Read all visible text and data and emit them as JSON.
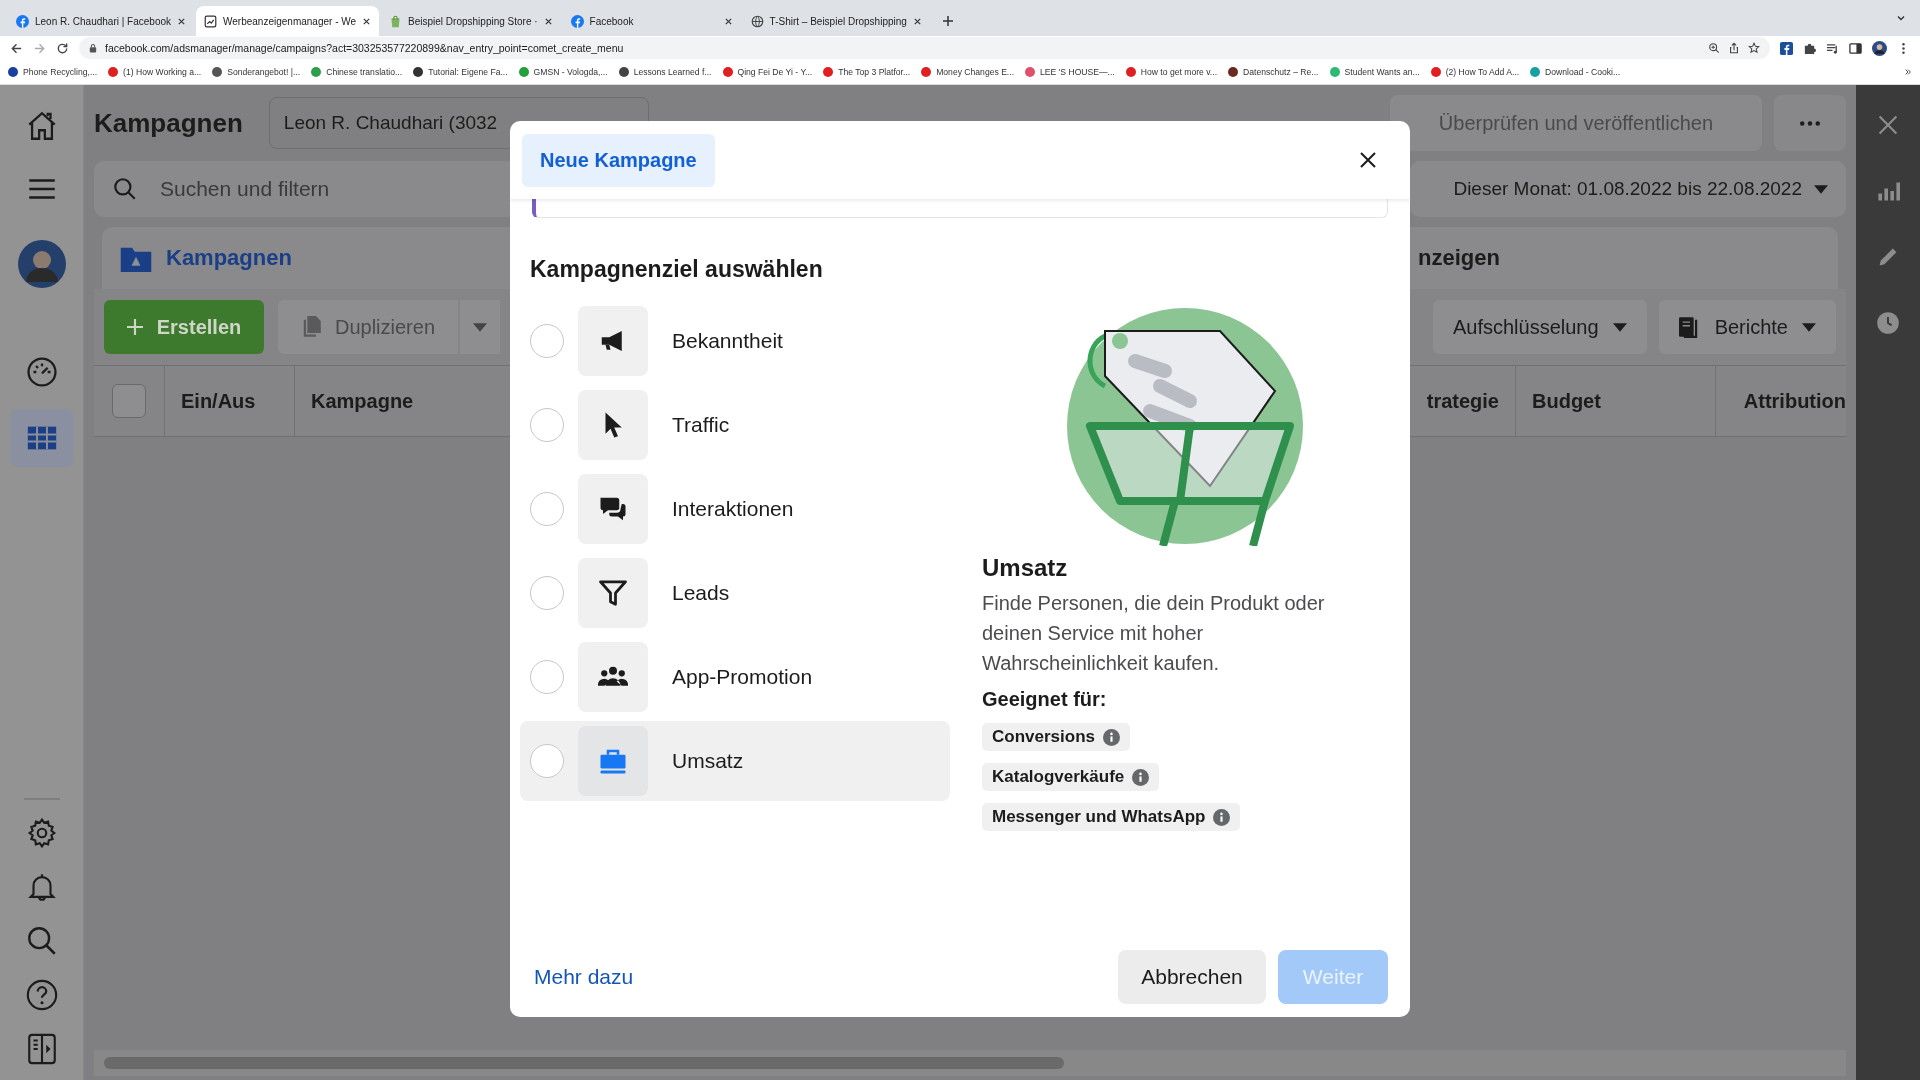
{
  "browser": {
    "tabs": [
      {
        "title": "Leon R. Chaudhari | Facebook",
        "kind": "facebook",
        "selected": false
      },
      {
        "title": "Werbeanzeigenmanager - We",
        "kind": "ads",
        "selected": true
      },
      {
        "title": "Beispiel Dropshipping Store ·",
        "kind": "shop",
        "selected": false
      },
      {
        "title": "Facebook",
        "kind": "facebook",
        "selected": false
      },
      {
        "title": "T-Shirt – Beispiel Dropshipping",
        "kind": "globe",
        "selected": false
      }
    ],
    "address": "facebook.com/adsmanager/manage/campaigns?act=303253577220899&nav_entry_point=comet_create_menu",
    "bookmarks": [
      {
        "title": "Phone Recycling,...",
        "color": "#1a3fa0"
      },
      {
        "title": "(1) How Working a...",
        "color": "#e02020"
      },
      {
        "title": "Sonderangebot! |...",
        "color": "#555555"
      },
      {
        "title": "Chinese translatio...",
        "color": "#2e9e4a"
      },
      {
        "title": "Tutorial: Eigene Fa...",
        "color": "#333333"
      },
      {
        "title": "GMSN - Vologda,...",
        "color": "#22a03a"
      },
      {
        "title": "Lessons Learned f...",
        "color": "#444444"
      },
      {
        "title": "Qing Fei De Yi - Y...",
        "color": "#e02020"
      },
      {
        "title": "The Top 3 Platfor...",
        "color": "#e02020"
      },
      {
        "title": "Money Changes E...",
        "color": "#e02020"
      },
      {
        "title": "LEE 'S HOUSE—...",
        "color": "#e0506a"
      },
      {
        "title": "How to get more v...",
        "color": "#e02020"
      },
      {
        "title": "Datenschutz – Re...",
        "color": "#6a2a20"
      },
      {
        "title": "Student Wants an...",
        "color": "#2eb872"
      },
      {
        "title": "(2) How To Add A...",
        "color": "#e02020"
      },
      {
        "title": "Download - Cooki...",
        "color": "#1aa0a0"
      }
    ]
  },
  "app": {
    "title": "Kampagnen",
    "account": "Leon R. Chaudhari (3032",
    "publish_button": "Überprüfen und veröffentlichen",
    "search": {
      "placeholder": "Suchen und filtern"
    },
    "date_range": "Dieser Monat: 01.08.2022 bis 22.08.2022",
    "section_tab": "Kampagnen",
    "section_right": "nzeigen",
    "create_button": "Erstellen",
    "duplicate_button": "Duplizieren",
    "breakdown_button": "Aufschlüsselung",
    "reports_button": "Berichte",
    "select_all_checked": false,
    "columns_left": [
      "Ein/Aus",
      "Kampagne"
    ],
    "columns_right": [
      "trategie",
      "Budget",
      "Attribution"
    ]
  },
  "modal": {
    "tab": "Neue Kampagne",
    "heading": "Kampagnenziel auswählen",
    "objectives": [
      {
        "label": "Bekanntheit",
        "kind": "megaphone",
        "selected": false,
        "highlighted": false
      },
      {
        "label": "Traffic",
        "kind": "cursor",
        "selected": false,
        "highlighted": false
      },
      {
        "label": "Interaktionen",
        "kind": "chat",
        "selected": false,
        "highlighted": false
      },
      {
        "label": "Leads",
        "kind": "funnel",
        "selected": false,
        "highlighted": false
      },
      {
        "label": "App-Promotion",
        "kind": "people",
        "selected": false,
        "highlighted": false
      },
      {
        "label": "Umsatz",
        "kind": "bag",
        "selected": false,
        "highlighted": true
      }
    ],
    "preview": {
      "title": "Umsatz",
      "description": "Finde Personen, die dein Produkt oder deinen Service mit hoher Wahrscheinlichkeit kaufen.",
      "suitable_label": "Geeignet für:",
      "tags": [
        "Conversions",
        "Katalogverkäufe",
        "Messenger und WhatsApp"
      ]
    },
    "link": "Mehr dazu",
    "cancel_button": "Abbrechen",
    "next_button": {
      "label": "Weiter",
      "disabled": true
    }
  }
}
